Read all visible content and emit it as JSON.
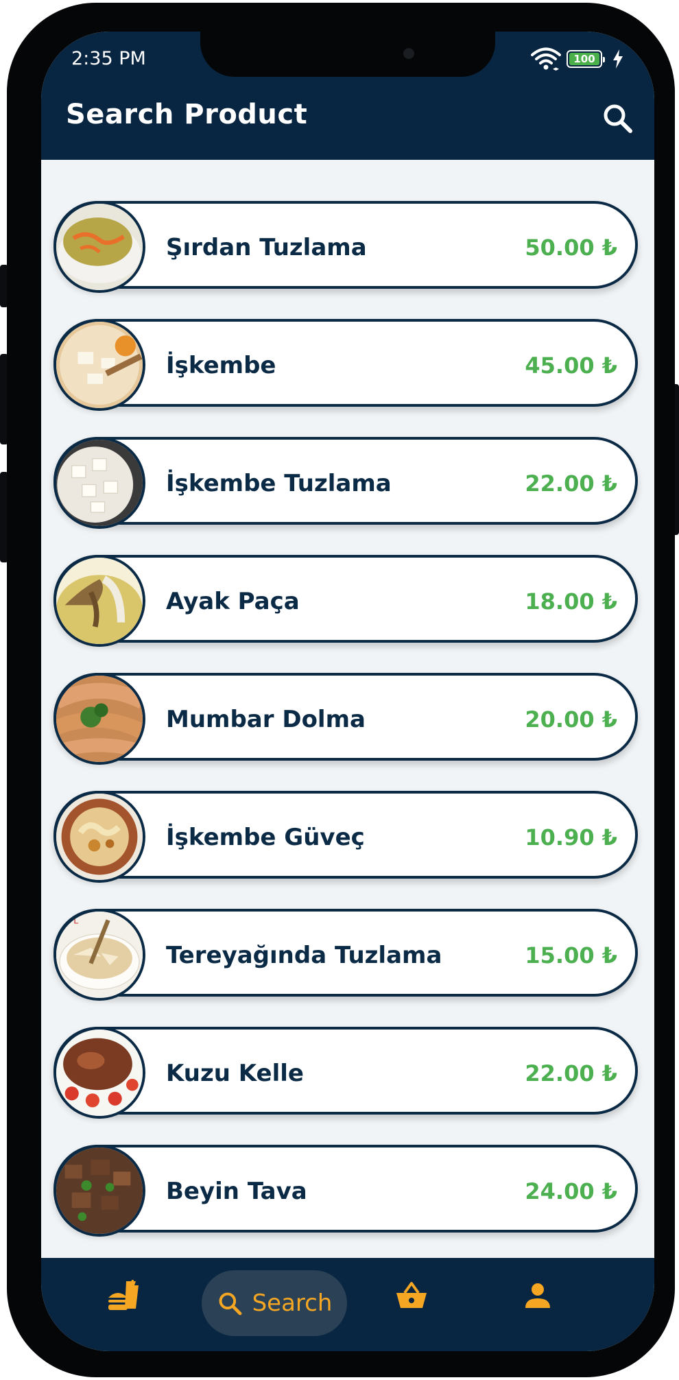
{
  "status_bar": {
    "time": "2:35 PM",
    "battery": "100"
  },
  "header": {
    "title": "Search Product"
  },
  "products": [
    {
      "name": "Şırdan Tuzlama",
      "price": "50.00 ₺"
    },
    {
      "name": "İşkembe",
      "price": "45.00 ₺"
    },
    {
      "name": "İşkembe Tuzlama",
      "price": "22.00 ₺"
    },
    {
      "name": "Ayak Paça",
      "price": "18.00 ₺"
    },
    {
      "name": "Mumbar Dolma",
      "price": "20.00 ₺"
    },
    {
      "name": "İşkembe Güveç",
      "price": "10.90 ₺"
    },
    {
      "name": "Tereyağında Tuzlama",
      "price": "15.00 ₺"
    },
    {
      "name": "Kuzu Kelle",
      "price": "22.00 ₺"
    },
    {
      "name": "Beyin Tava",
      "price": "24.00 ₺"
    },
    {
      "name": "",
      "price": ""
    }
  ],
  "bottom_nav": {
    "items": [
      {
        "icon": "fastfood-icon"
      },
      {
        "icon": "search-icon",
        "label": "Search",
        "active": true
      },
      {
        "icon": "basket-icon"
      },
      {
        "icon": "person-icon"
      }
    ]
  },
  "colors": {
    "header": "#082541",
    "accent": "#f5a623",
    "price": "#4caf50",
    "border": "#0b2a45",
    "background": "#f1f4f6"
  }
}
